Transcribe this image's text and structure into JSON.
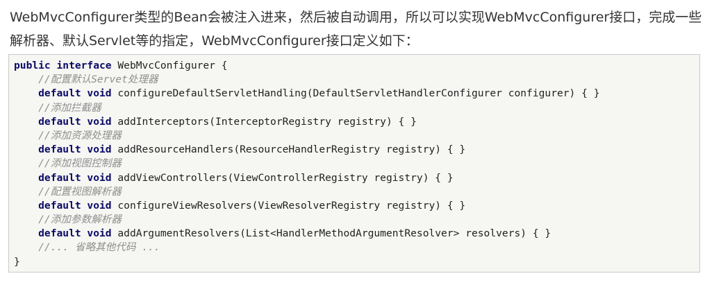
{
  "paragraph": {
    "line1": "WebMvcConfigurer类型的Bean会被注入进来，然后被自动调用，所以可以实现WebMvcConfigurer接口，完成一些",
    "line2": "解析器、默认Servlet等的指定，WebMvcConfigurer接口定义如下："
  },
  "code": {
    "l1_kw": "public interface",
    "l1_text": " WebMvcConfigurer {",
    "l2_cm": "    //配置默认Servet处理器",
    "l3_kw": "    default void",
    "l3_text": " configureDefaultServletHandling(DefaultServletHandlerConfigurer configurer) { }",
    "l4_cm": "    //添加拦截器",
    "l5_kw": "    default void",
    "l5_text": " addInterceptors(InterceptorRegistry registry) { }",
    "l6_cm": "    //添加资源处理器",
    "l7_kw": "    default void",
    "l7_text": " addResourceHandlers(ResourceHandlerRegistry registry) { }",
    "l8_cm": "    //添加视图控制器",
    "l9_kw": "    default void",
    "l9_text": " addViewControllers(ViewControllerRegistry registry) { }",
    "l10_cm": "    //配置视图解析器",
    "l11_kw": "    default void",
    "l11_text": " configureViewResolvers(ViewResolverRegistry registry) { }",
    "l12_cm": "    //添加参数解析器",
    "l13_kw": "    default void",
    "l13_text": " addArgumentResolvers(List<HandlerMethodArgumentResolver> resolvers) { }",
    "l14_cm": "    //... 省略其他代码 ...",
    "l15_text": "}"
  },
  "colors": {
    "keyword": "#0b0b66",
    "comment": "#8f8f8f",
    "code_background": "#f6f6f3"
  }
}
